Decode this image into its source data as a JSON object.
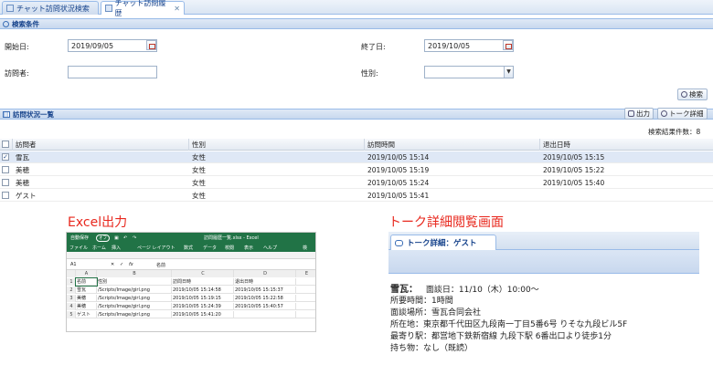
{
  "tabs": [
    {
      "label": "チャット訪問状況検索",
      "active": false,
      "closable": false
    },
    {
      "label": "チャット訪問履歴",
      "active": true,
      "closable": true
    }
  ],
  "search_panel": {
    "title": "検索条件",
    "start_label": "開始日:",
    "start_value": "2019/09/05",
    "end_label": "終了日:",
    "end_value": "2019/10/05",
    "visitor_label": "訪問者:",
    "visitor_value": "",
    "gender_label": "性別:",
    "gender_value": "",
    "search_button": "検索"
  },
  "list_panel": {
    "title": "訪問状況一覧",
    "export_button": "出力",
    "talk_detail_button": "トーク詳細",
    "result_count": "検索結果件数：8",
    "columns": [
      "訪問者",
      "性別",
      "訪問時間",
      "退出日時"
    ],
    "rows": [
      {
        "checked": true,
        "visitor": "雪瓦",
        "gender": "女性",
        "visit": "2019/10/05 15:14",
        "exit": "2019/10/05 15:15"
      },
      {
        "checked": false,
        "visitor": "美穂",
        "gender": "女性",
        "visit": "2019/10/05 15:19",
        "exit": "2019/10/05 15:22"
      },
      {
        "checked": false,
        "visitor": "美穂",
        "gender": "女性",
        "visit": "2019/10/05 15:24",
        "exit": "2019/10/05 15:40"
      },
      {
        "checked": false,
        "visitor": "ゲスト",
        "gender": "女性",
        "visit": "2019/10/05 15:41",
        "exit": ""
      }
    ]
  },
  "captions": {
    "excel": "Excel出力",
    "talk": "トーク詳細閲覧画面"
  },
  "excel": {
    "autosave": "自動保存",
    "toggle": "オフ",
    "filename": "訪問履歴一覧.xlsx - Excel",
    "menu": [
      "ファイル",
      "ホーム",
      "挿入",
      "ページ レイアウト",
      "数式",
      "データ",
      "校閲",
      "表示",
      "ヘルプ",
      "検"
    ],
    "cell_ref": "A1",
    "formula": "名前",
    "col_headers": [
      "A",
      "B",
      "C",
      "D",
      "E"
    ],
    "rows": [
      [
        "1",
        "名前",
        "性別",
        "訪問日時",
        "退出日時"
      ],
      [
        "2",
        "雪瓦",
        "/Scripts/Image/girl.png",
        "2019/10/05 15:14:58",
        "2019/10/05 15:15:37"
      ],
      [
        "3",
        "美穂",
        "/Scripts/Image/girl.png",
        "2019/10/05 15:19:15",
        "2019/10/05 15:22:58"
      ],
      [
        "4",
        "美穂",
        "/Scripts/Image/girl.png",
        "2019/10/05 15:24:39",
        "2019/10/05 15:40:57"
      ],
      [
        "5",
        "ゲスト",
        "/Scripts/Image/girl.png",
        "2019/10/05 15:41:20",
        ""
      ]
    ]
  },
  "talk_detail": {
    "tab_label": "トーク詳細：ゲスト",
    "name": "雪瓦：",
    "meeting_date": "面談日：11/10（木）10:00〜",
    "lines": [
      "所要時間：1時間",
      "面談場所：雪瓦合同会社",
      "所在地：東京都千代田区九段南一丁目5番6号 りそな九段ビル5F",
      "最寄り駅：都営地下鉄新宿線 九段下駅 6番出口より徒歩1分",
      "持ち物：なし（既読）"
    ]
  }
}
